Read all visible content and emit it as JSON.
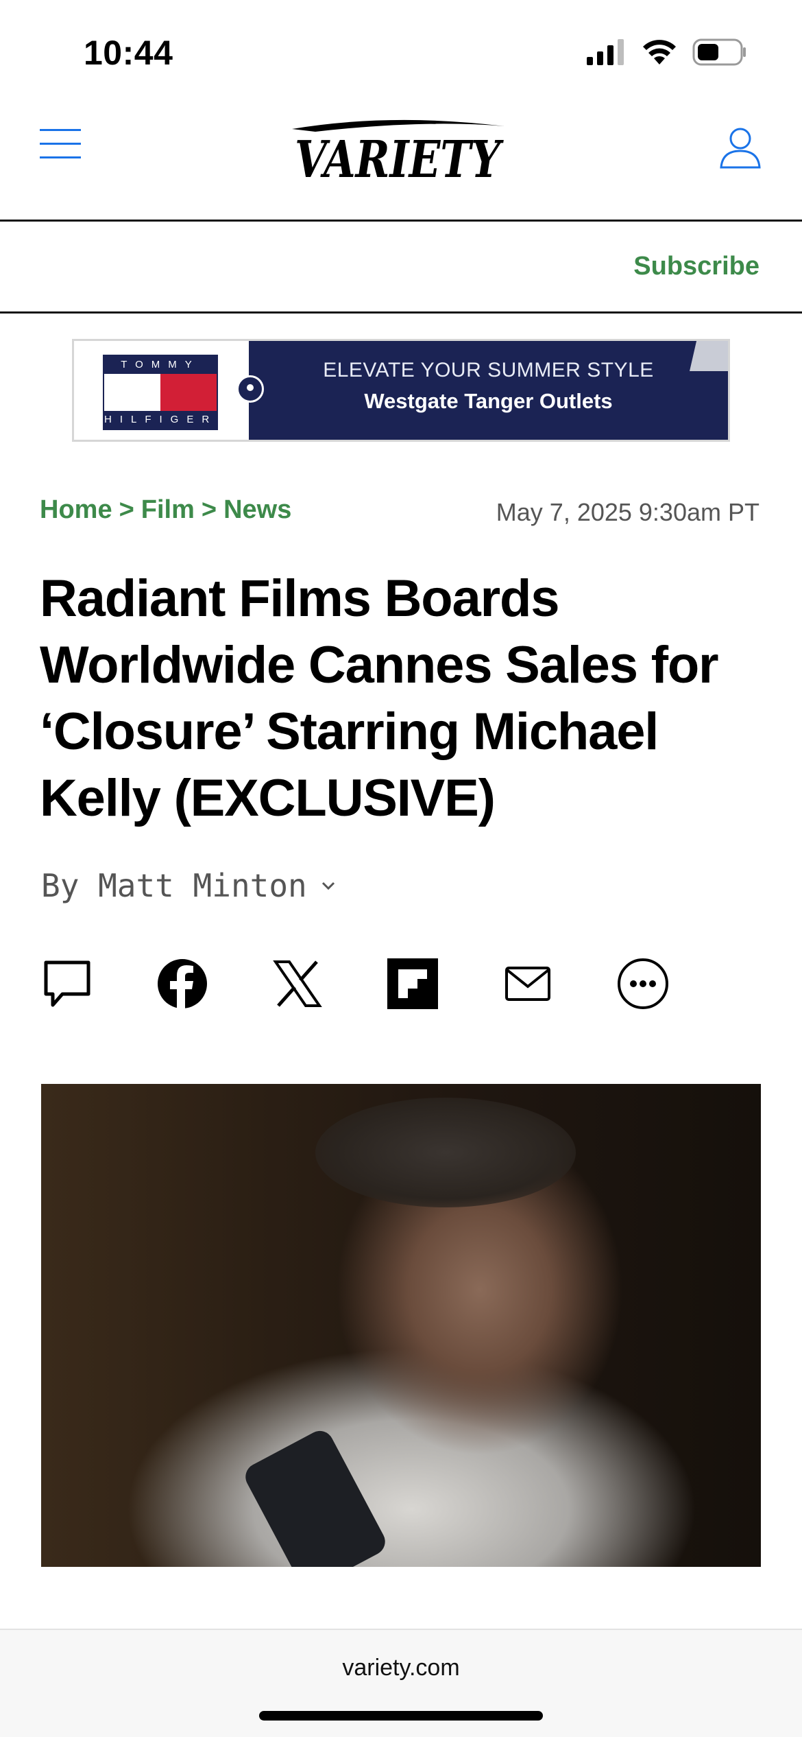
{
  "status_bar": {
    "time": "10:44",
    "icons": [
      "signal-icon",
      "wifi-icon",
      "battery-icon"
    ]
  },
  "header": {
    "logo_text": "VARIETY",
    "menu_icon": "menu-icon",
    "account_icon": "account-icon",
    "accent_color": "#1a73e8"
  },
  "subscribe": {
    "label": "Subscribe",
    "color": "#3d8a4a"
  },
  "ad": {
    "brand_top": "TOMMY",
    "brand_bottom": "HILFIGER",
    "line1": "ELEVATE YOUR SUMMER STYLE",
    "line2": "Westgate Tanger Outlets",
    "bg_color": "#1b2354"
  },
  "article": {
    "breadcrumb": [
      {
        "label": "Home"
      },
      {
        "label": "Film"
      },
      {
        "label": "News"
      }
    ],
    "breadcrumb_sep": ">",
    "date": "May 7, 2025 9:30am PT",
    "headline": "Radiant Films Boards Worldwide Cannes Sales for ‘Closure’ Starring Michael Kelly (EXCLUSIVE)",
    "byline": "By Matt Minton",
    "share": [
      "comment-icon",
      "facebook-icon",
      "x-icon",
      "flipboard-icon",
      "email-icon",
      "more-icon"
    ]
  },
  "browser": {
    "url": "variety.com"
  }
}
